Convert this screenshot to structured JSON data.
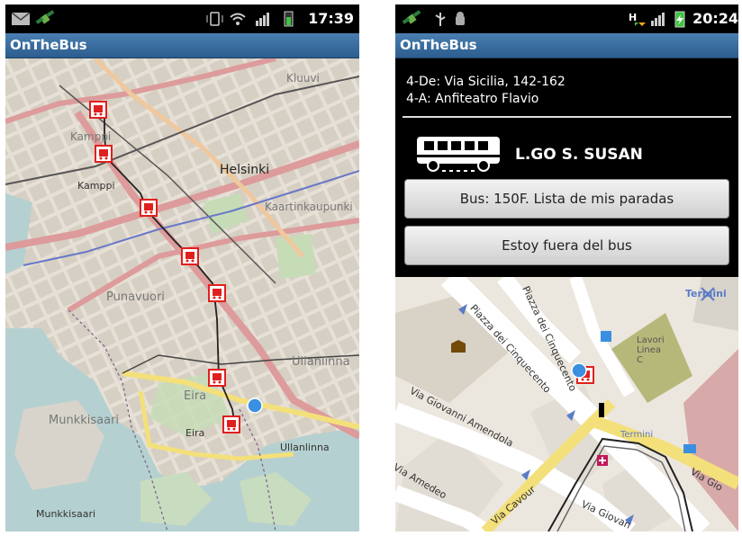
{
  "left": {
    "status": {
      "time": "17:39"
    },
    "app_title": "OnTheBus",
    "map_labels": {
      "city": "Helsinki",
      "kamppi1": "Kamppi",
      "kamppi2": "Kamppi",
      "kaartinkaupunki": "Kaartinkaupunki",
      "kluuvi": "Kluuvi",
      "punavuori": "Punavuori",
      "ullanlinna": "Ullanlinna",
      "eira1": "Eira",
      "eira2": "Eira",
      "munkkisaari1": "Munkkisaari",
      "munkkisaari2": "Munkkisaari",
      "ullanlinna2": "Ullanlinna"
    }
  },
  "right": {
    "status": {
      "time": "20:24"
    },
    "app_title": "OnTheBus",
    "route_from": "4-De: Via Sicilia, 142-162",
    "route_to": "4-A: Anfiteatro Flavio",
    "stop_name": "L.GO S. SUSAN",
    "btn_stops": "Bus: 150F. Lista de mis paradas",
    "btn_out": "Estoy fuera del bus",
    "map_labels": {
      "termini": "Termini",
      "termini2": "Termini",
      "lavori": "Lavori\nLinea\nC",
      "cinquecento1": "Piazza dei Cinquecento",
      "cinquecento2": "Piazza dei Cinquecento",
      "amendola": "Via Giovanni Amendola",
      "amedeo": "Via Amedeo",
      "cavour": "Via Cavour",
      "giovanni": "Via Giovan",
      "viagio": "Via Gio"
    }
  },
  "colors": {
    "title_bar": "#3a6d9f",
    "stop_marker": "#e0201e",
    "location": "#3b8fe0"
  }
}
